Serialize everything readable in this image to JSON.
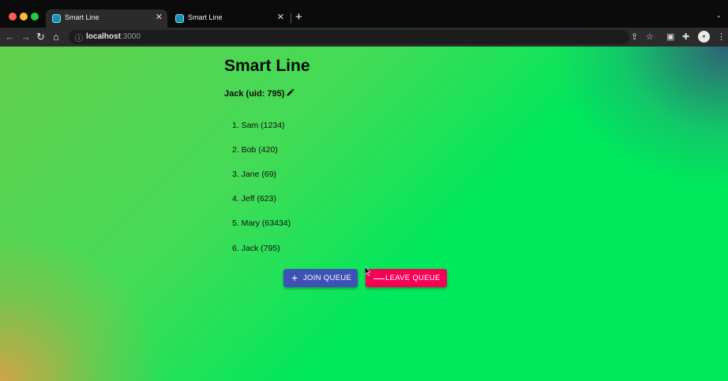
{
  "browser": {
    "tabs": [
      {
        "title": "Smart Line",
        "close": "✕"
      },
      {
        "title": "Smart Line",
        "close": "✕"
      }
    ],
    "new_tab": "+",
    "url_host": "localhost",
    "url_port": ":3000"
  },
  "app": {
    "title": "Smart Line",
    "current_user": "Jack (uid: 795)",
    "queue": [
      "1. Sam (1234)",
      "2. Bob (420)",
      "3. Jane (69)",
      "4. Jeff (623)",
      "5. Mary (63434)",
      "6. Jack (795)"
    ],
    "join_button": {
      "icon": "+",
      "label": "JOIN QUEUE"
    },
    "leave_button": {
      "icon": "—",
      "label": "LEAVE QUEUE"
    }
  },
  "colors": {
    "join": "#3f51b5",
    "leave": "#f50057",
    "gradient_green": "#00e85c"
  }
}
